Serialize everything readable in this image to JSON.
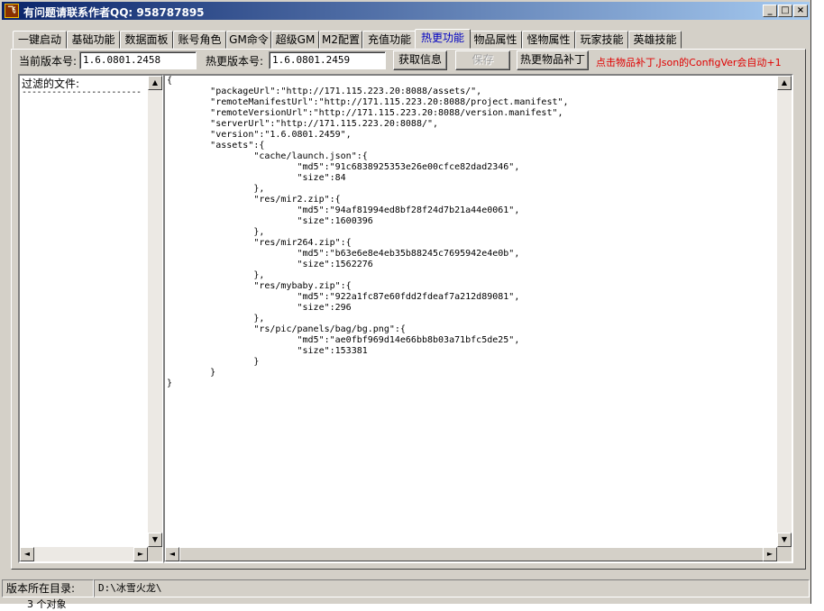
{
  "window": {
    "title": "有问题请联系作者QQ: 958787895",
    "app_icon": "飞",
    "buttons": {
      "minimize": "_",
      "maximize": "□",
      "close": "×"
    }
  },
  "tabs": [
    {
      "label": "一键启动"
    },
    {
      "label": "基础功能"
    },
    {
      "label": "数据面板"
    },
    {
      "label": "账号角色"
    },
    {
      "label": "GM命令"
    },
    {
      "label": "超级GM"
    },
    {
      "label": "M2配置"
    },
    {
      "label": "充值功能"
    },
    {
      "label": "热更功能",
      "active": true
    },
    {
      "label": "物品属性"
    },
    {
      "label": "怪物属性"
    },
    {
      "label": "玩家技能"
    },
    {
      "label": "英雄技能"
    }
  ],
  "toolbar": {
    "current_version_label": "当前版本号:",
    "current_version_value": "1.6.0801.2458",
    "hot_version_label": "热更版本号:",
    "hot_version_value": "1.6.0801.2459",
    "fetch_button": "获取信息",
    "save_button": "保存",
    "patch_button": "热更物品补丁",
    "hint": "点击物品补丁,Json的ConfigVer会自动+1"
  },
  "filter": {
    "label": "过滤的文件:",
    "separator": "------------------------"
  },
  "json_text": "{\n\t\"packageUrl\":\"http://171.115.223.20:8088/assets/\",\n\t\"remoteManifestUrl\":\"http://171.115.223.20:8088/project.manifest\",\n\t\"remoteVersionUrl\":\"http://171.115.223.20:8088/version.manifest\",\n\t\"serverUrl\":\"http://171.115.223.20:8088/\",\n\t\"version\":\"1.6.0801.2459\",\n\t\"assets\":{\n\t\t\"cache/launch.json\":{\n\t\t\t\"md5\":\"91c6838925353e26e00cfce82dad2346\",\n\t\t\t\"size\":84\n\t\t},\n\t\t\"res/mir2.zip\":{\n\t\t\t\"md5\":\"94af81994ed8bf28f24d7b21a44e0061\",\n\t\t\t\"size\":1600396\n\t\t},\n\t\t\"res/mir264.zip\":{\n\t\t\t\"md5\":\"b63e6e8e4eb35b88245c7695942e4e0b\",\n\t\t\t\"size\":1562276\n\t\t},\n\t\t\"res/mybaby.zip\":{\n\t\t\t\"md5\":\"922a1fc87e60fdd2fdeaf7a212d89081\",\n\t\t\t\"size\":296\n\t\t},\n\t\t\"rs/pic/panels/bag/bg.png\":{\n\t\t\t\"md5\":\"ae0fbf969d14e66bb8b03a71bfc5de25\",\n\t\t\t\"size\":153381\n\t\t}\n\t}\n}",
  "scroll_arrows": {
    "up": "▲",
    "down": "▼",
    "left": "◄",
    "right": "►"
  },
  "status": {
    "dir_label": "版本所在目录:",
    "dir_value": "D:\\冰雪火龙\\"
  },
  "below_text": "3 个对象"
}
